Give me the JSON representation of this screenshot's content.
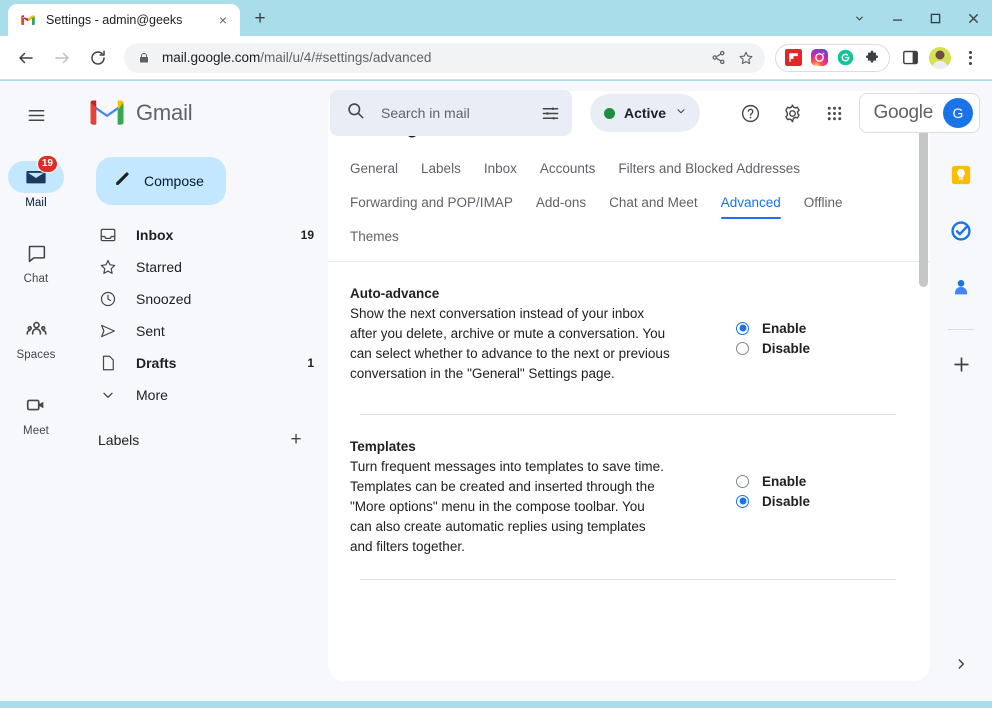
{
  "browser": {
    "tab": {
      "title": "Settings - admin@geeks",
      "favicon": "gmail-icon",
      "close": "×"
    },
    "new_tab_label": "+",
    "window_controls": {
      "tab_search": "tab-search-chevron",
      "minimize": "–",
      "maximize": "□",
      "close": "✕"
    },
    "nav": {
      "back": "back-arrow",
      "forward": "forward-arrow",
      "reload": "reload-icon"
    },
    "omnibox": {
      "lock": "lock-icon",
      "url_domain": "mail.google.com",
      "url_path": "/mail/u/4/#settings/advanced",
      "share": "share-icon",
      "bookmark": "star-icon"
    },
    "extensions": [
      "flipboard-icon",
      "instagram-icon",
      "grammarly-icon",
      "puzzle-icon"
    ],
    "side_panel_icon": "side-panel-icon",
    "profile_icon": "profile-avatar",
    "menu_icon": "chrome-menu-icon"
  },
  "rail": {
    "menu": "hamburger-icon",
    "items": [
      {
        "label": "Mail",
        "icon": "mail-icon",
        "badge": "19",
        "active": true
      },
      {
        "label": "Chat",
        "icon": "chat-icon",
        "badge": "",
        "active": false
      },
      {
        "label": "Spaces",
        "icon": "spaces-icon",
        "badge": "",
        "active": false
      },
      {
        "label": "Meet",
        "icon": "meet-icon",
        "badge": "",
        "active": false
      }
    ]
  },
  "gmail": {
    "brand": "Gmail",
    "compose": "Compose",
    "nav_items": [
      {
        "label": "Inbox",
        "count": "19",
        "icon": "inbox-icon",
        "bold": true
      },
      {
        "label": "Starred",
        "count": "",
        "icon": "star-outline-icon",
        "bold": false
      },
      {
        "label": "Snoozed",
        "count": "",
        "icon": "clock-icon",
        "bold": false
      },
      {
        "label": "Sent",
        "count": "",
        "icon": "send-icon",
        "bold": false
      },
      {
        "label": "Drafts",
        "count": "1",
        "icon": "draft-icon",
        "bold": true
      },
      {
        "label": "More",
        "count": "",
        "icon": "chevron-down-icon",
        "bold": false
      }
    ],
    "labels_title": "Labels",
    "labels_add": "+"
  },
  "topbar": {
    "search_placeholder": "Search in mail",
    "search_value": "",
    "search_options_icon": "tune-icon",
    "status_label": "Active",
    "status_color": "#1e8e3e",
    "status_chevron": "chevron-down-icon",
    "help_icon": "help-icon",
    "settings_icon": "gear-icon",
    "apps_icon": "apps-grid-icon",
    "account_text": "Google",
    "account_initial": "G"
  },
  "settings": {
    "title": "Settings",
    "input_tools_icon": "keyboard-icon",
    "input_tools_chevron": "chevron-down-icon",
    "tabs": [
      {
        "label": "General",
        "active": false
      },
      {
        "label": "Labels",
        "active": false
      },
      {
        "label": "Inbox",
        "active": false
      },
      {
        "label": "Accounts",
        "active": false
      },
      {
        "label": "Filters and Blocked Addresses",
        "active": false
      },
      {
        "label": "Forwarding and POP/IMAP",
        "active": false
      },
      {
        "label": "Add-ons",
        "active": false
      },
      {
        "label": "Chat and Meet",
        "active": false
      },
      {
        "label": "Advanced",
        "active": true
      },
      {
        "label": "Offline",
        "active": false
      },
      {
        "label": "Themes",
        "active": false
      }
    ],
    "sections": [
      {
        "title": "Auto-advance",
        "description": "Show the next conversation instead of your inbox after you delete, archive or mute a conversation. You can select whether to advance to the next or previous conversation in the \"General\" Settings page.",
        "options": [
          {
            "label": "Enable",
            "selected": true
          },
          {
            "label": "Disable",
            "selected": false
          }
        ]
      },
      {
        "title": "Templates",
        "description": "Turn frequent messages into templates to save time. Templates can be created and inserted through the \"More options\" menu in the compose toolbar. You can also create automatic replies using templates and filters together.",
        "options": [
          {
            "label": "Enable",
            "selected": false
          },
          {
            "label": "Disable",
            "selected": true
          }
        ]
      }
    ]
  },
  "side_panel": {
    "items": [
      "calendar-icon",
      "keep-icon",
      "tasks-icon",
      "contacts-icon"
    ],
    "add_label": "+",
    "expand_icon": "chevron-right-icon"
  },
  "colors": {
    "accent_blue": "#1a73e8",
    "compose_blue": "#c2e7ff",
    "badge_red": "#d93025",
    "status_green": "#1e8e3e",
    "titlebar": "#a9dde9"
  }
}
